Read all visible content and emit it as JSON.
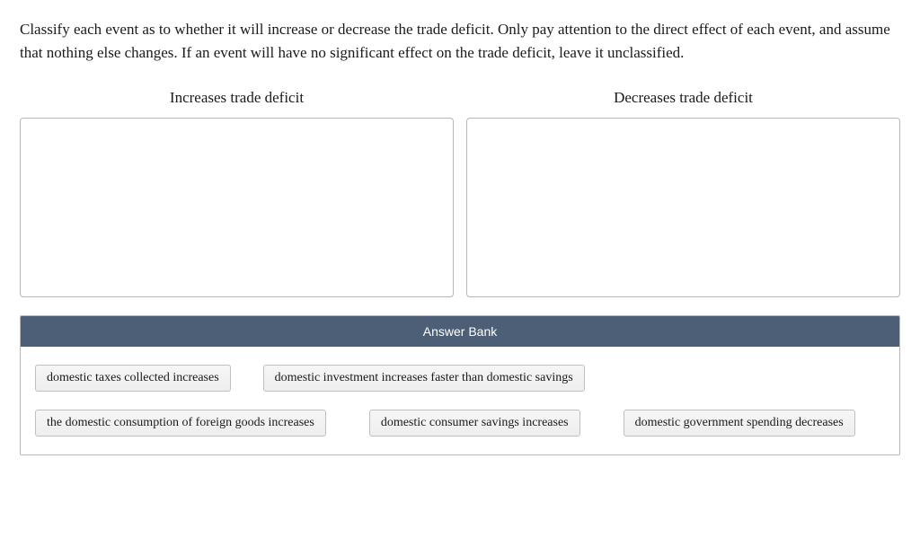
{
  "instructions": "Classify each event as to whether it will increase or decrease the trade deficit. Only pay attention to the direct effect of each event, and assume that nothing else changes. If an event will have no significant effect on the trade deficit, leave it unclassified.",
  "columns": {
    "left_label": "Increases trade deficit",
    "right_label": "Decreases trade deficit"
  },
  "answer_bank": {
    "header": "Answer Bank",
    "items": {
      "item1": "domestic taxes collected increases",
      "item2": "domestic investment increases faster than domestic savings",
      "item3": "the domestic consumption of foreign goods increases",
      "item4": "domestic consumer savings increases",
      "item5": "domestic government spending decreases"
    }
  }
}
